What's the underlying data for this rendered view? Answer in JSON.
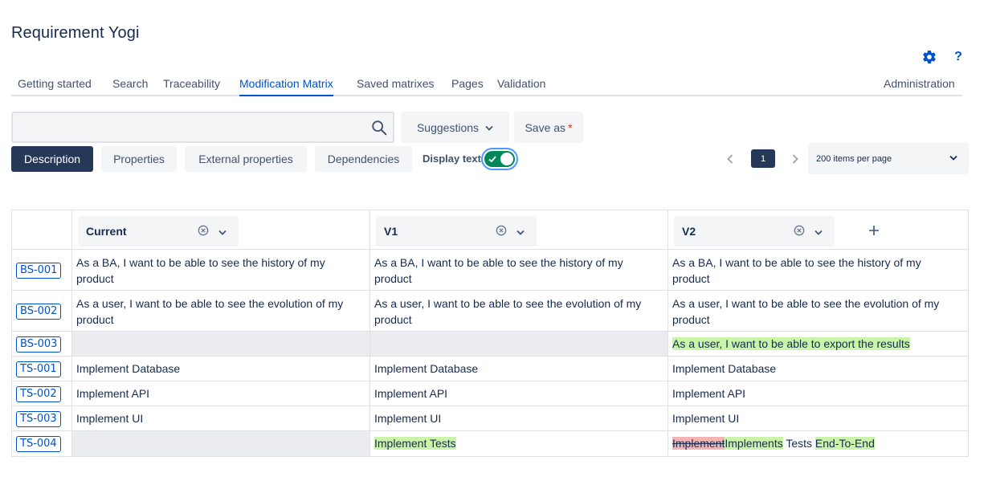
{
  "app": {
    "title": "Requirement Yogi"
  },
  "tabs": [
    {
      "label": "Getting started"
    },
    {
      "label": "Search"
    },
    {
      "label": "Traceability"
    },
    {
      "label": "Modification Matrix",
      "active": true
    },
    {
      "label": "Saved matrixes"
    },
    {
      "label": "Pages"
    },
    {
      "label": "Validation"
    }
  ],
  "admin_label": "Administration",
  "top_icons": {
    "settings": "gear-icon",
    "help_label": "?"
  },
  "search": {
    "value": "",
    "placeholder": ""
  },
  "toolbar": {
    "suggestions_label": "Suggestions",
    "save_as_label": "Save as",
    "save_as_required": "*"
  },
  "views": {
    "description_label": "Description",
    "properties_label": "Properties",
    "external_properties_label": "External properties",
    "dependencies_label": "Dependencies"
  },
  "display_text": {
    "label": "Display text",
    "enabled": true
  },
  "pager": {
    "current_page": "1",
    "per_page_label": "200 items per page"
  },
  "columns": [
    {
      "label": "Current"
    },
    {
      "label": "V1"
    },
    {
      "label": "V2"
    }
  ],
  "rows": [
    {
      "key": "BS-001",
      "current": "As a BA, I want to be able to see the history of my product",
      "v1": "As a BA, I want to be able to see the history of my product",
      "v2": "As a BA, I want to be able to see the history of my product"
    },
    {
      "key": "BS-002",
      "current": "As a user, I want to be able to see the evolution of my product",
      "v1": "As a user, I want to be able to see the evolution of my product",
      "v2": "As a user, I want to be able to see the evolution of my product"
    },
    {
      "key": "BS-003",
      "current": "",
      "v1": "",
      "v2": "As a user, I want to be able to export the results"
    },
    {
      "key": "TS-001",
      "current": "Implement Database",
      "v1": "Implement Database",
      "v2": "Implement Database"
    },
    {
      "key": "TS-002",
      "current": "Implement API",
      "v1": "Implement API",
      "v2": "Implement API"
    },
    {
      "key": "TS-003",
      "current": "Implement UI",
      "v1": "Implement UI",
      "v2": "Implement UI"
    },
    {
      "key": "TS-004",
      "current": "",
      "v1": "Implement Tests",
      "v2_parts": {
        "deleted": "Implement",
        "added1": "Implements",
        "plain": " Tests ",
        "added2": "End-To-End"
      }
    }
  ],
  "colors": {
    "accent": "#0052cc",
    "primary_button": "#253858",
    "added_highlight": "#c9f4a9",
    "deleted_highlight": "#f5b4b4",
    "toggle_on": "#00875a",
    "required": "#de350b"
  }
}
